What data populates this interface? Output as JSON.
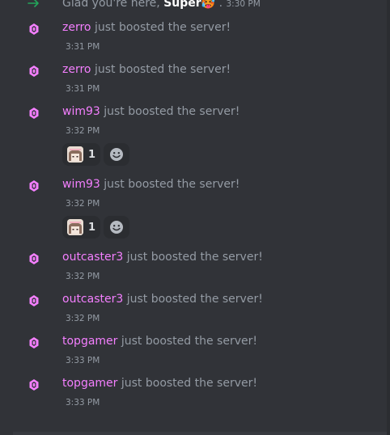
{
  "join_message": {
    "prefix": "Glad you're here,",
    "user": "Super",
    "emoji": "🥵",
    "separator": ".",
    "time": "3:30 PM"
  },
  "boost_text": "just boosted the server!",
  "messages": [
    {
      "user": "zerro",
      "time": "3:31 PM"
    },
    {
      "user": "zerro",
      "time": "3:31 PM"
    },
    {
      "user": "wim93",
      "time": "3:32 PM",
      "reaction_count": "1"
    },
    {
      "user": "wim93",
      "time": "3:32 PM",
      "reaction_count": "1"
    },
    {
      "user": "outcaster3",
      "time": "3:32 PM"
    },
    {
      "user": "outcaster3",
      "time": "3:32 PM"
    },
    {
      "user": "topgamer",
      "time": "3:33 PM"
    },
    {
      "user": "topgamer",
      "time": "3:33 PM"
    }
  ],
  "colors": {
    "background": "#313338",
    "boost_pink": "#f47fff",
    "join_green": "#23a55a",
    "muted_text": "#949ba4"
  },
  "icons": {
    "join": "arrow-right-icon",
    "boost": "server-boost-gem-icon",
    "add_reaction": "smiley-add-reaction-icon"
  }
}
